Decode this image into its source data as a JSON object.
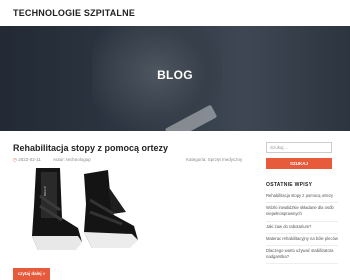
{
  "site": {
    "title": "TECHNOLOGIE SZPITALNE"
  },
  "hero": {
    "title": "BLOG"
  },
  "post": {
    "title": "Rehabilitacja stopy z pomocą ortezy",
    "date": "2022-02-11",
    "author": "Autor: technologop",
    "category": "Kategoria: Sprzęt medyczny",
    "read_more": "czytaj dalej »"
  },
  "sidebar": {
    "search_placeholder": "Szukaj ...",
    "search_button": "SZUKAJ",
    "recent_title": "OSTATNIE WPISY",
    "recent_posts": [
      "Rehabilitacja stopy z pomocą ortezy",
      "Wózki inwalidzkie składane dla osób niepełnosprawnych",
      "Jaki żaw do rabotarium?",
      "Materac rehabilitacyjny na bóle pleców",
      "Dlaczego warto używać stabilizatora nadgarstka?"
    ]
  },
  "colors": {
    "accent": "#e85a3c"
  }
}
